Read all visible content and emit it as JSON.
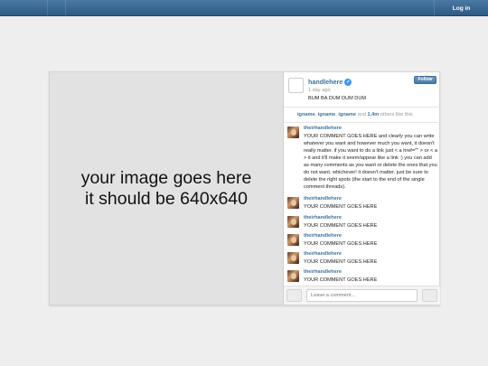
{
  "topbar": {
    "login_label": "Log in"
  },
  "photo": {
    "line1": "your image goes here",
    "line2": "it should be 640x640"
  },
  "post": {
    "handle": "handlehere",
    "time": "1 day ago",
    "caption": "BUM BA DUM DUM DUM",
    "follow_label": "Follow"
  },
  "likes": {
    "name1": "igname",
    "name2": "igname",
    "name3": "igname",
    "count_prefix": "and",
    "count": "1.4m",
    "suffix": "others like this."
  },
  "comments": [
    {
      "user": "theirhandlehere",
      "text": "YOUR COMMENT GOES HERE and clearly you can write whatever you want and however much you want, it doesn't really matter. if you want to do a link just < a href=\"\" > or < a > it and it'll make it seem/appear like a link :) you can add as many comments as you want or delete the ones that you do not want. whichever! it doesn't matter. just be sure to delete the right spots (the start to the end of the single comment threads)."
    },
    {
      "user": "theirhandlehere",
      "text": "YOUR COMMENT GOES HERE"
    },
    {
      "user": "theirhandlehere",
      "text": "YOUR COMMENT GOES HERE"
    },
    {
      "user": "theirhandlehere",
      "text": "YOUR COMMENT GOES HERE"
    },
    {
      "user": "theirhandlehere",
      "text": "YOUR COMMENT GOES HERE"
    },
    {
      "user": "theirhandlehere",
      "text": "YOUR COMMENT GOES HERE"
    }
  ],
  "comment_input": {
    "placeholder": "Leave a comment..."
  },
  "colors": {
    "topbar": "#3b6896",
    "link": "#3f729b",
    "verified": "#3897f0"
  }
}
